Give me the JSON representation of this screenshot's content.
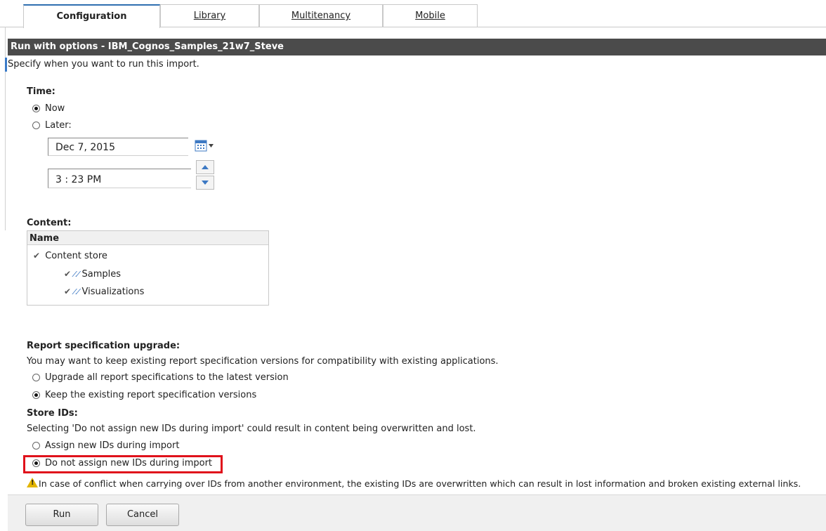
{
  "tabs": [
    {
      "label": "Configuration",
      "active": true
    },
    {
      "label": "Library",
      "active": false
    },
    {
      "label": "Multitenancy",
      "active": false
    },
    {
      "label": "Mobile",
      "active": false
    }
  ],
  "dialog": {
    "title": "Run with options - IBM_Cognos_Samples_21w7_Steve",
    "intro": "Specify when you want to run this import."
  },
  "time": {
    "heading": "Time:",
    "now_label": "Now",
    "later_label": "Later:",
    "date_value": "Dec 7, 2015",
    "time_value": "3 : 23  PM",
    "selected": "now"
  },
  "content": {
    "heading": "Content:",
    "column_header": "Name",
    "items": [
      {
        "label": "Content store",
        "level": 0,
        "icon": "check-icon"
      },
      {
        "label": "Samples",
        "level": 1,
        "icon": "check-pencil-icon"
      },
      {
        "label": "Visualizations",
        "level": 1,
        "icon": "check-pencil-icon"
      }
    ]
  },
  "report_spec": {
    "heading": "Report specification upgrade:",
    "description": "You may want to keep existing report specification versions for compatibility with existing applications.",
    "option_upgrade": "Upgrade all report specifications to the latest version",
    "option_keep": "Keep the existing report specification versions",
    "selected": "keep"
  },
  "store_ids": {
    "heading": "Store IDs:",
    "description": "Selecting 'Do not assign new IDs during import' could result in content being overwritten and lost.",
    "option_assign": "Assign new IDs during import",
    "option_no_assign": "Do not assign new IDs during import",
    "selected": "no_assign",
    "highlight_color": "#e0111b"
  },
  "warning": {
    "icon": "warning-icon",
    "text": "In case of conflict when carrying over IDs from another environment, the existing IDs are overwritten which can result in lost information and broken existing external links."
  },
  "buttons": {
    "run_label": "Run",
    "cancel_label": "Cancel"
  },
  "colors": {
    "titlebar_bg": "#4b4b4b",
    "accent": "#2f6fb0"
  }
}
